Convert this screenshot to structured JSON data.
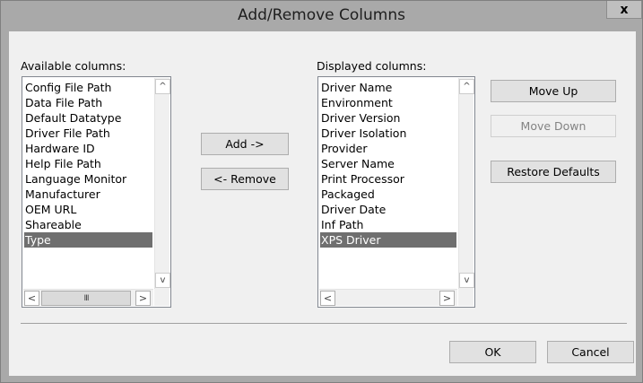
{
  "window": {
    "title": "Add/Remove Columns",
    "close_label": "x"
  },
  "available": {
    "label": "Available columns:",
    "items": [
      "Config File Path",
      "Data File Path",
      "Default Datatype",
      "Driver File Path",
      "Hardware ID",
      "Help File Path",
      "Language Monitor",
      "Manufacturer",
      "OEM URL",
      "Shareable",
      "Type"
    ],
    "selected": "Type"
  },
  "displayed": {
    "label": "Displayed columns:",
    "items": [
      "Driver Name",
      "Environment",
      "Driver Version",
      "Driver Isolation",
      "Provider",
      "Server Name",
      "Print Processor",
      "Packaged",
      "Driver Date",
      "Inf Path",
      "XPS Driver"
    ],
    "selected": "XPS Driver"
  },
  "buttons": {
    "add": "Add ->",
    "remove": "<- Remove",
    "move_up": "Move Up",
    "move_down": "Move Down",
    "restore_defaults": "Restore Defaults",
    "ok": "OK",
    "cancel": "Cancel"
  },
  "icons": {
    "scroll_up": "^",
    "scroll_down": "v",
    "scroll_left": "<",
    "scroll_right": ">",
    "thumb_grip": "III"
  },
  "colors": {
    "selection": "#6f6f6f",
    "titlebar": "#a9a9a9",
    "client": "#f0f0f0"
  }
}
